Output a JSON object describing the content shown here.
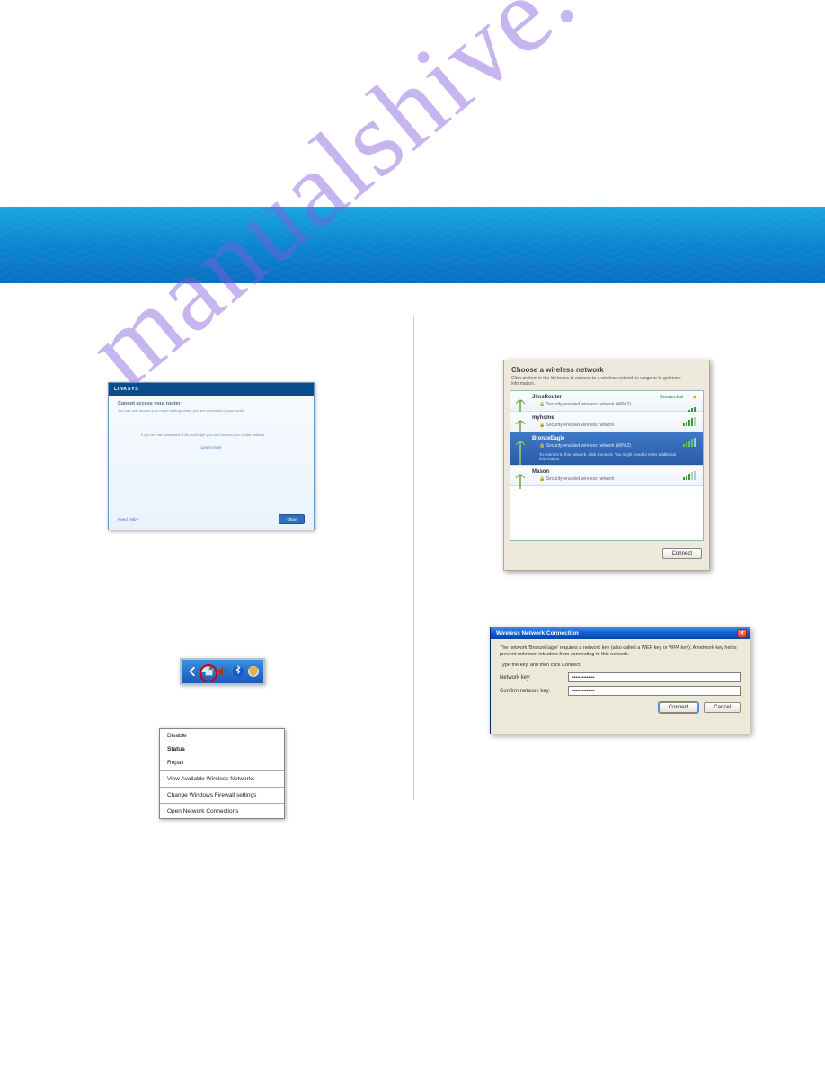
{
  "linksys": {
    "brand": "LINKSYS",
    "title": "Cannot access your router",
    "subtitle": "You can only access your router settings when you are connected to your router.",
    "message": "If you are not connected to BronzeEagle you can't access your router settings.",
    "learn_more_label": "Learn more",
    "help_label": "Need help?",
    "ok_label": "Okay"
  },
  "context_menu": {
    "items": [
      "Disable",
      "Status",
      "Repair",
      "View Available Wireless Networks",
      "Change Windows Firewall settings",
      "Open Network Connections"
    ]
  },
  "wireless_panel": {
    "title": "Choose a wireless network",
    "subtitle": "Click an item in the list below to connect to a wireless network in range or to get more information.",
    "connect_label": "Connect",
    "networks": [
      {
        "name": "JimsRouter",
        "security": "Security-enabled wireless network (WPA2)",
        "connected_label": "Connected"
      },
      {
        "name": "myhome",
        "security": "Security-enabled wireless network"
      },
      {
        "name": "BronzeEagle",
        "security": "Security-enabled wireless network (WPA2)",
        "extra": "To connect to this network, click Connect. You might need to enter additional information."
      },
      {
        "name": "Mason",
        "security": "Security-enabled wireless network"
      }
    ]
  },
  "key_dialog": {
    "title": "Wireless Network Connection",
    "description": "The network 'BronzeEagle' requires a network key (also called a WEP key or WPA key). A network key helps prevent unknown intruders from connecting to this network.",
    "instruction": "Type the key, and then click Connect.",
    "network_key_label": "Network key:",
    "confirm_key_label": "Confirm network key:",
    "network_key_value": "••••••••••••••",
    "confirm_key_value": "••••••••••••••",
    "connect_label": "Connect",
    "cancel_label": "Cancel"
  },
  "watermark_text": "manualshive.com"
}
